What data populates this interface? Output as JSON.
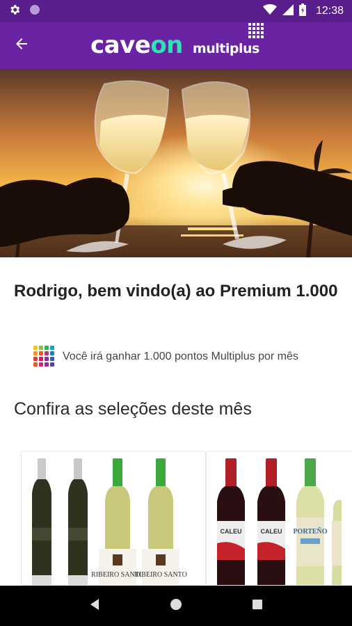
{
  "status_bar": {
    "time": "12:38",
    "icons": [
      "gear-icon",
      "circle-icon",
      "wifi-icon",
      "signal-icon",
      "battery-icon"
    ]
  },
  "app_bar": {
    "brand_caveon_prefix": "cave",
    "brand_caveon_suffix": "on",
    "brand_multiplus": "multiplus",
    "back_icon": "arrow-left-icon"
  },
  "welcome": {
    "title": "Rodrigo, bem vindo(a) ao Premium 1.000"
  },
  "points": {
    "text": "Você irá ganhar 1.000 pontos Multiplus por mês"
  },
  "selections": {
    "title": "Confira as seleções deste mês"
  },
  "products": [
    {
      "bottles": [
        {
          "label": ""
        },
        {
          "label": ""
        },
        {
          "label": "RIBEIRO SANTO"
        },
        {
          "label": "RIBEIRO SANTO"
        }
      ]
    },
    {
      "bottles": [
        {
          "label": "CALEU"
        },
        {
          "label": "CALEU"
        },
        {
          "label": "PORTEÑO"
        }
      ]
    }
  ],
  "colors": {
    "status_bar": "#5a1e8c",
    "app_bar": "#6a23a3",
    "brand_accent": "#2ee2b4"
  },
  "nav_bar": {
    "icons": [
      "back-triangle-icon",
      "home-circle-icon",
      "recents-square-icon"
    ]
  }
}
